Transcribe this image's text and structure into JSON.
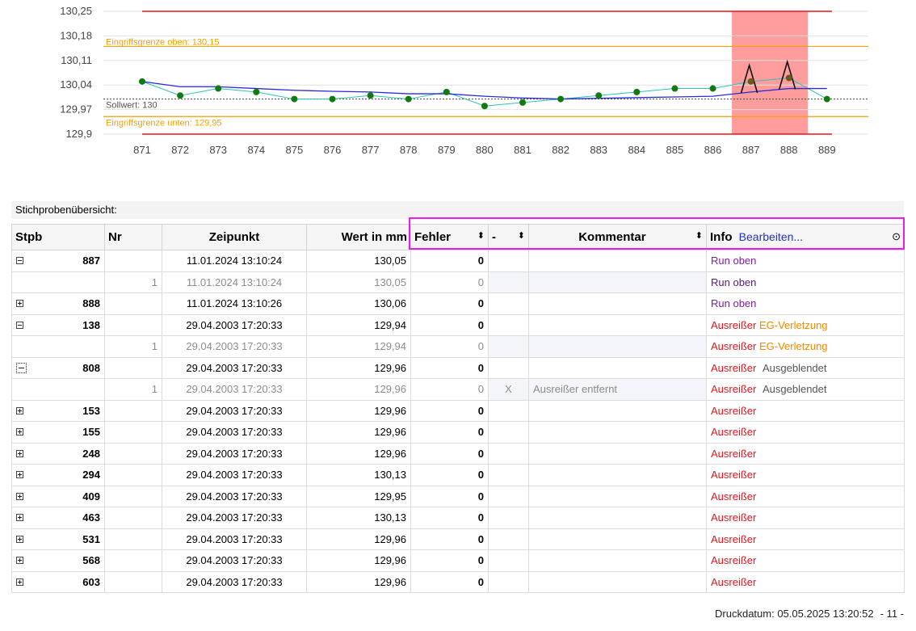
{
  "chart_data": {
    "type": "line",
    "title": "",
    "xlabel": "",
    "ylabel": "",
    "x": [
      "871",
      "872",
      "873",
      "874",
      "875",
      "876",
      "877",
      "878",
      "879",
      "880",
      "881",
      "882",
      "883",
      "884",
      "885",
      "886",
      "887",
      "888",
      "889"
    ],
    "y_ticks": [
      "130,25",
      "130,18",
      "130,11",
      "130,04",
      "129,97",
      "129,9"
    ],
    "ylim": [
      129.9,
      130.25
    ],
    "grid": true,
    "series": [
      {
        "values": [
          130.05,
          130.01,
          130.03,
          130.02,
          130.0,
          130.0,
          130.01,
          130.0,
          130.02,
          129.98,
          129.99,
          130.0,
          130.01,
          130.02,
          130.03,
          130.03,
          130.05,
          130.06,
          130.0
        ]
      },
      {
        "values": [
          130.05,
          130.035,
          130.035,
          130.03,
          130.025,
          130.022,
          130.02,
          130.015,
          130.015,
          130.008,
          130.003,
          130.0,
          130.002,
          130.004,
          130.006,
          130.008,
          130.02,
          130.03,
          130.03
        ]
      }
    ],
    "reference_lines": [
      {
        "label": "",
        "value": 130.25,
        "color": "#e8141a"
      },
      {
        "label": "Eingriffsgrenze oben: 130,15",
        "value": 130.15,
        "color": "#f2a100"
      },
      {
        "label": "Sollwert: 130",
        "value": 130.0,
        "color": "#555555"
      },
      {
        "label": "Eingriffsgrenze unten: 129,95",
        "value": 129.95,
        "color": "#f2a100"
      },
      {
        "label": "",
        "value": 129.9,
        "color": "#e8141a"
      }
    ],
    "highlight_range": [
      "887",
      "888"
    ],
    "run_markers": [
      "887",
      "888"
    ],
    "colors": {
      "points": "#0f7a0f",
      "series1": "#2ec4b6",
      "series2": "#2a2ad6",
      "highlight": "#ff9c9c"
    }
  },
  "section_title": "Stichprobenübersicht:",
  "table": {
    "headers": {
      "stpb": "Stpb",
      "nr": "Nr",
      "zeitpunkt": "Zeipunkt",
      "wert": "Wert in mm",
      "fehler": "Fehler",
      "minus": "-",
      "kommentar": "Kommentar",
      "info": "Info",
      "info_link": "Bearbeiten..."
    },
    "rows": [
      {
        "expander": "minus",
        "stpb": "887",
        "nr": "",
        "zeit": "11.01.2024 13:10:24",
        "wert": "130,05",
        "fehler": "0",
        "minus": "",
        "kommentar": "",
        "info": [
          {
            "text": "Run oben",
            "style": "run"
          }
        ]
      },
      {
        "child": true,
        "expander": "",
        "stpb": "",
        "nr": "1",
        "zeit": "11.01.2024 13:10:24",
        "wert": "130,05",
        "fehler": "0",
        "minus": "",
        "kommentar": "",
        "info": [
          {
            "text": "Run oben",
            "style": "run-dark"
          }
        ]
      },
      {
        "expander": "plus",
        "stpb": "888",
        "nr": "",
        "zeit": "11.01.2024 13:10:26",
        "wert": "130,06",
        "fehler": "0",
        "minus": "",
        "kommentar": "",
        "info": [
          {
            "text": "Run oben",
            "style": "run"
          }
        ]
      },
      {
        "expander": "minus",
        "stpb": "138",
        "nr": "",
        "zeit": "29.04.2003 17:20:33",
        "wert": "129,94",
        "fehler": "0",
        "minus": "",
        "kommentar": "",
        "info": [
          {
            "text": "Ausreißer",
            "style": "aus"
          },
          {
            "text": "EG-Verletzung",
            "style": "eg"
          }
        ]
      },
      {
        "child": true,
        "expander": "",
        "stpb": "",
        "nr": "1",
        "zeit": "29.04.2003 17:20:33",
        "wert": "129,94",
        "fehler": "0",
        "minus": "",
        "kommentar": "",
        "info": [
          {
            "text": "Ausreißer",
            "style": "aus"
          },
          {
            "text": "EG-Verletzung",
            "style": "eg"
          }
        ]
      },
      {
        "expander": "dotted",
        "stpb": "808",
        "nr": "",
        "zeit": "29.04.2003 17:20:33",
        "wert": "129,96",
        "fehler": "0",
        "minus": "",
        "kommentar": "",
        "info": [
          {
            "text": "Ausreißer",
            "style": "aus"
          },
          {
            "text": "Ausgeblendet",
            "style": "ausgebl"
          }
        ]
      },
      {
        "child": true,
        "expander": "",
        "stpb": "",
        "nr": "1",
        "zeit": "29.04.2003 17:20:33",
        "wert": "129,96",
        "fehler": "0",
        "minus": "X",
        "kommentar": "Ausreißer entfernt",
        "info": [
          {
            "text": "Ausreißer",
            "style": "aus"
          },
          {
            "text": "Ausgeblendet",
            "style": "ausgebl"
          }
        ]
      },
      {
        "expander": "plus",
        "stpb": "153",
        "nr": "",
        "zeit": "29.04.2003 17:20:33",
        "wert": "129,96",
        "fehler": "0",
        "minus": "",
        "kommentar": "",
        "info": [
          {
            "text": "Ausreißer",
            "style": "aus"
          }
        ]
      },
      {
        "expander": "plus",
        "stpb": "155",
        "nr": "",
        "zeit": "29.04.2003 17:20:33",
        "wert": "129,96",
        "fehler": "0",
        "minus": "",
        "kommentar": "",
        "info": [
          {
            "text": "Ausreißer",
            "style": "aus"
          }
        ]
      },
      {
        "expander": "plus",
        "stpb": "248",
        "nr": "",
        "zeit": "29.04.2003 17:20:33",
        "wert": "129,96",
        "fehler": "0",
        "minus": "",
        "kommentar": "",
        "info": [
          {
            "text": "Ausreißer",
            "style": "aus"
          }
        ]
      },
      {
        "expander": "plus",
        "stpb": "294",
        "nr": "",
        "zeit": "29.04.2003 17:20:33",
        "wert": "130,13",
        "fehler": "0",
        "minus": "",
        "kommentar": "",
        "info": [
          {
            "text": "Ausreißer",
            "style": "aus"
          }
        ]
      },
      {
        "expander": "plus",
        "stpb": "409",
        "nr": "",
        "zeit": "29.04.2003 17:20:33",
        "wert": "129,95",
        "fehler": "0",
        "minus": "",
        "kommentar": "",
        "info": [
          {
            "text": "Ausreißer",
            "style": "aus"
          }
        ]
      },
      {
        "expander": "plus",
        "stpb": "463",
        "nr": "",
        "zeit": "29.04.2003 17:20:33",
        "wert": "130,13",
        "fehler": "0",
        "minus": "",
        "kommentar": "",
        "info": [
          {
            "text": "Ausreißer",
            "style": "aus"
          }
        ]
      },
      {
        "expander": "plus",
        "stpb": "531",
        "nr": "",
        "zeit": "29.04.2003 17:20:33",
        "wert": "129,96",
        "fehler": "0",
        "minus": "",
        "kommentar": "",
        "info": [
          {
            "text": "Ausreißer",
            "style": "aus"
          }
        ]
      },
      {
        "expander": "plus",
        "stpb": "568",
        "nr": "",
        "zeit": "29.04.2003 17:20:33",
        "wert": "129,96",
        "fehler": "0",
        "minus": "",
        "kommentar": "",
        "info": [
          {
            "text": "Ausreißer",
            "style": "aus"
          }
        ]
      },
      {
        "expander": "plus",
        "stpb": "603",
        "nr": "",
        "zeit": "29.04.2003 17:20:33",
        "wert": "129,96",
        "fehler": "0",
        "minus": "",
        "kommentar": "",
        "info": [
          {
            "text": "Ausreißer",
            "style": "aus"
          }
        ]
      }
    ]
  },
  "footer": {
    "druckdatum": "Druckdatum: 05.05.2025 13:20:52",
    "page": "- 11 -"
  }
}
